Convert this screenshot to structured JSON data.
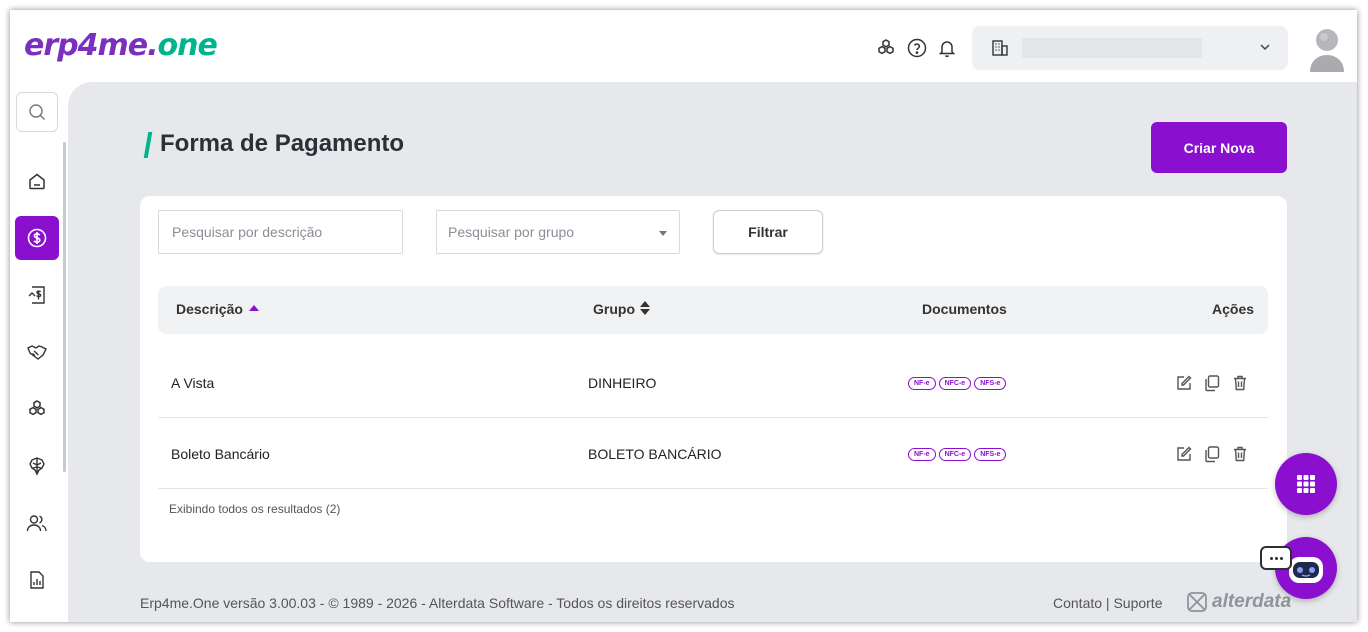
{
  "header": {
    "logo_main": "erp4me.",
    "logo_accent": "one",
    "icons": [
      "modules-icon",
      "help-icon",
      "bell-icon"
    ],
    "company_icon": "building-icon",
    "chevron_icon": "chevron-down-icon"
  },
  "sidebar": {
    "items": [
      {
        "name": "home",
        "icon": "home-icon",
        "active": false
      },
      {
        "name": "finance",
        "icon": "dollar-circle-icon",
        "active": true
      },
      {
        "name": "invoices",
        "icon": "invoice-icon",
        "active": false
      },
      {
        "name": "partners",
        "icon": "handshake-icon",
        "active": false
      },
      {
        "name": "products",
        "icon": "boxes-icon",
        "active": false
      },
      {
        "name": "integrations",
        "icon": "brain-icon",
        "active": false
      },
      {
        "name": "people",
        "icon": "users-icon",
        "active": false
      },
      {
        "name": "reports",
        "icon": "report-icon",
        "active": false
      }
    ]
  },
  "page": {
    "title": "Forma de Pagamento",
    "create_button": "Criar Nova"
  },
  "filters": {
    "description_placeholder": "Pesquisar por descrição",
    "group_placeholder": "Pesquisar por grupo",
    "filter_button": "Filtrar"
  },
  "table": {
    "columns": {
      "descricao": "Descrição",
      "grupo": "Grupo",
      "documentos": "Documentos",
      "acoes": "Ações"
    },
    "rows": [
      {
        "descricao": "A Vista",
        "grupo": "DINHEIRO",
        "docs": [
          "NF-e",
          "NFC-e",
          "NFS-e"
        ]
      },
      {
        "descricao": "Boleto Bancário",
        "grupo": "BOLETO BANCÁRIO",
        "docs": [
          "NF-e",
          "NFC-e",
          "NFS-e"
        ]
      }
    ],
    "result_info": "Exibindo todos os resultados (2)"
  },
  "footer": {
    "copyright": "Erp4me.One versão 3.00.03 - © 1989 - 2026 - Alterdata Software - Todos os direitos reservados",
    "links": "Contato | Suporte",
    "brand": "alterdata"
  },
  "colors": {
    "brand_purple": "#8a0fcf",
    "accent_green": "#00b58d",
    "background": "#e6e8eb"
  }
}
